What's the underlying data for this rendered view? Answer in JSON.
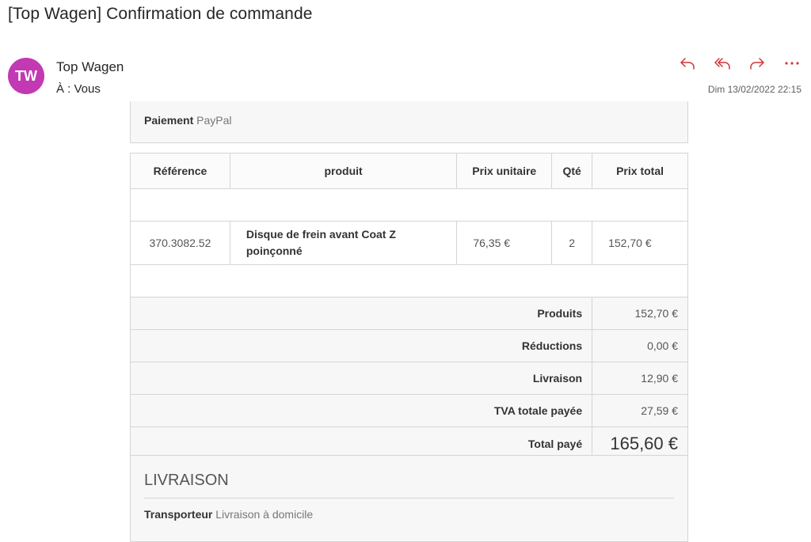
{
  "email": {
    "subject": "[Top Wagen] Confirmation de commande",
    "avatar_initials": "TW",
    "avatar_color": "#c239b3",
    "sender": "Top Wagen",
    "to": "À : Vous",
    "date": "Dim 13/02/2022 22:15",
    "actions": [
      {
        "icon": "reply-icon"
      },
      {
        "icon": "reply-all-icon"
      },
      {
        "icon": "forward-icon"
      },
      {
        "icon": "more-icon"
      }
    ],
    "action_color": "#d13438"
  },
  "payment": {
    "label": "Paiement",
    "value": "PayPal"
  },
  "order": {
    "headers": [
      "Référence",
      "produit",
      "Prix unitaire",
      "Qté",
      "Prix total"
    ],
    "items": [
      {
        "ref": "370.3082.52",
        "product": "Disque de frein avant Coat Z poinçonné",
        "unit_price": "76,35 €",
        "qty": "2",
        "total": "152,70 €"
      }
    ],
    "summary": [
      {
        "label": "Produits",
        "value": "152,70 €"
      },
      {
        "label": "Réductions",
        "value": "0,00 €"
      },
      {
        "label": "Livraison",
        "value": "12,90 €"
      },
      {
        "label": "TVA totale payée",
        "value": "27,59 €"
      }
    ],
    "total": {
      "label": "Total payé",
      "value": "165,60 €"
    }
  },
  "shipping": {
    "title": "LIVRAISON",
    "carrier_label": "Transporteur",
    "carrier_value": "Livraison à domicile"
  }
}
